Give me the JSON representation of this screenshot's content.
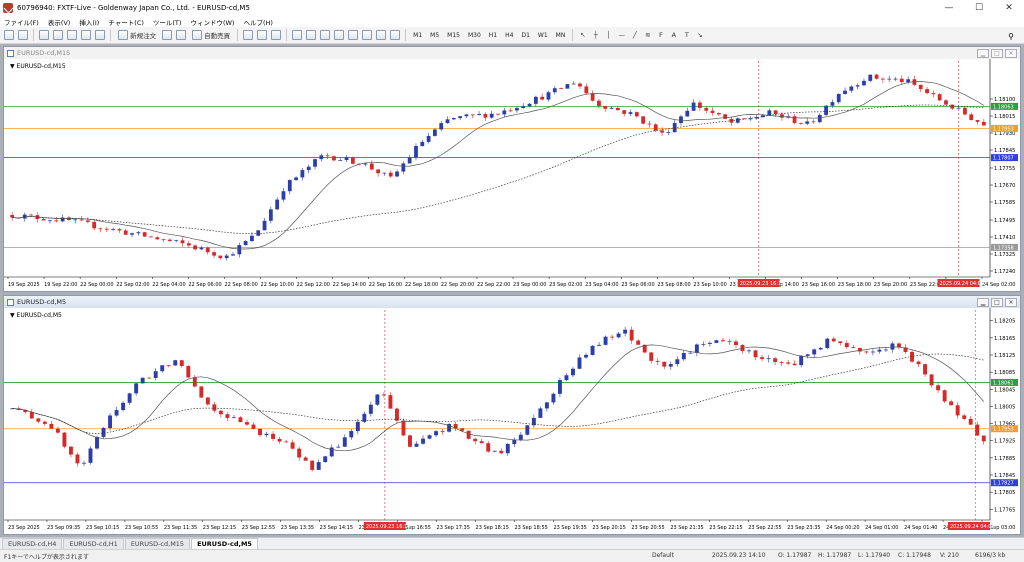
{
  "app": {
    "title": "60796940: FXTF-Live - Goldenway Japan Co., Ltd. - EURUSD-cd,M5",
    "window_controls": [
      "—",
      "☐",
      "✕"
    ]
  },
  "menu": [
    "ファイル(F)",
    "表示(V)",
    "挿入(I)",
    "チャート(C)",
    "ツール(T)",
    "ウィンドウ(W)",
    "ヘルプ(H)"
  ],
  "toolbar": {
    "new_order": "新規注文",
    "auto_trade": "自動売買",
    "timeframes": [
      "M1",
      "M5",
      "M15",
      "M30",
      "H1",
      "H4",
      "D1",
      "W1",
      "MN"
    ]
  },
  "charts": [
    {
      "window_title": "EURUSD-cd,M15",
      "label": "EURUSD-cd,M15",
      "active": false,
      "price_labels": [
        "1.18100",
        "1.18015",
        "1.17930",
        "1.17845",
        "1.17755",
        "1.17670",
        "1.17585",
        "1.17495",
        "1.17410",
        "1.17325",
        "1.17240"
      ],
      "price_range": [
        1.1721,
        1.1829
      ],
      "levels": [
        {
          "price": 1.18063,
          "color": "#2e9e3e",
          "label": "1.18063"
        },
        {
          "price": 1.17953,
          "color": "#f0a020",
          "label": "1.17953"
        },
        {
          "price": 1.17807,
          "color": "#2f3fe0",
          "label": "1.17807"
        },
        {
          "price": 1.17358,
          "color": "#9a9a9a",
          "label": "1.17358"
        }
      ],
      "time_labels": [
        "19 Sep 2025",
        "19 Sep 22:00",
        "22 Sep 00:00",
        "22 Sep 02:00",
        "22 Sep 04:00",
        "22 Sep 06:00",
        "22 Sep 08:00",
        "22 Sep 10:00",
        "22 Sep 12:00",
        "22 Sep 14:00",
        "22 Sep 16:00",
        "22 Sep 18:00",
        "22 Sep 20:00",
        "22 Sep 22:00",
        "23 Sep 00:00",
        "23 Sep 02:00",
        "23 Sep 04:00",
        "23 Sep 06:00",
        "23 Sep 08:00",
        "23 Sep 10:00",
        "23 Sep 12:00",
        "23 Sep 14:00",
        "23 Sep 16:00",
        "23 Sep 18:00",
        "23 Sep 20:00",
        "23 Sep 22:00",
        "24 Sep 00:00",
        "24 Sep 02:00"
      ],
      "markers": [
        "2025.09.23 16:15",
        "2025.09.24 04:00"
      ]
    },
    {
      "window_title": "EURUSD-cd,M5",
      "label": "EURUSD-cd,M5",
      "active": true,
      "price_labels": [
        "1.18205",
        "1.18165",
        "1.18125",
        "1.18085",
        "1.18045",
        "1.18005",
        "1.17965",
        "1.17925",
        "1.17885",
        "1.17845",
        "1.17805",
        "1.17765"
      ],
      "price_range": [
        1.1774,
        1.1823
      ],
      "levels": [
        {
          "price": 1.18061,
          "color": "#2e9e3e",
          "label": "1.18061"
        },
        {
          "price": 1.17953,
          "color": "#f0a020",
          "label": "1.17953"
        },
        {
          "price": 1.17827,
          "color": "#2f3fe0",
          "label": "1.17827"
        }
      ],
      "time_labels": [
        "23 Sep 2025",
        "23 Sep 09:35",
        "23 Sep 10:15",
        "23 Sep 10:55",
        "23 Sep 11:35",
        "23 Sep 12:15",
        "23 Sep 12:55",
        "23 Sep 13:35",
        "23 Sep 14:15",
        "23 Sep 14:55",
        "23 Sep 16:55",
        "23 Sep 17:35",
        "23 Sep 18:15",
        "23 Sep 18:55",
        "23 Sep 19:35",
        "23 Sep 20:15",
        "23 Sep 20:55",
        "23 Sep 21:35",
        "23 Sep 22:15",
        "23 Sep 22:55",
        "23 Sep 23:35",
        "24 Sep 00:20",
        "24 Sep 01:00",
        "24 Sep 01:40",
        "24 Sep 02:20",
        "24 Sep 03:00"
      ],
      "markers": [
        "2025.09.23 16:15",
        "2025.09.24 04:00"
      ]
    }
  ],
  "tabs": [
    "EURUSD-cd,H4",
    "EURUSD-cd,H1",
    "EURUSD-cd,M15",
    "EURUSD-cd,M5"
  ],
  "status": {
    "help": "F1キーでヘルプが表示されます",
    "profile": "Default",
    "datetime": "2025.09.23 14:10",
    "open": "O: 1.17987",
    "high": "H: 1.17987",
    "low": "L: 1.17940",
    "close": "C: 1.17948",
    "volume": "V: 210",
    "connection": "6196/3 kb"
  },
  "colors": {
    "bull": "#2c3ea8",
    "bear": "#d42a2a",
    "ma_fast": "#555555",
    "ma_slow": "#333333",
    "marker": "#e03030"
  }
}
